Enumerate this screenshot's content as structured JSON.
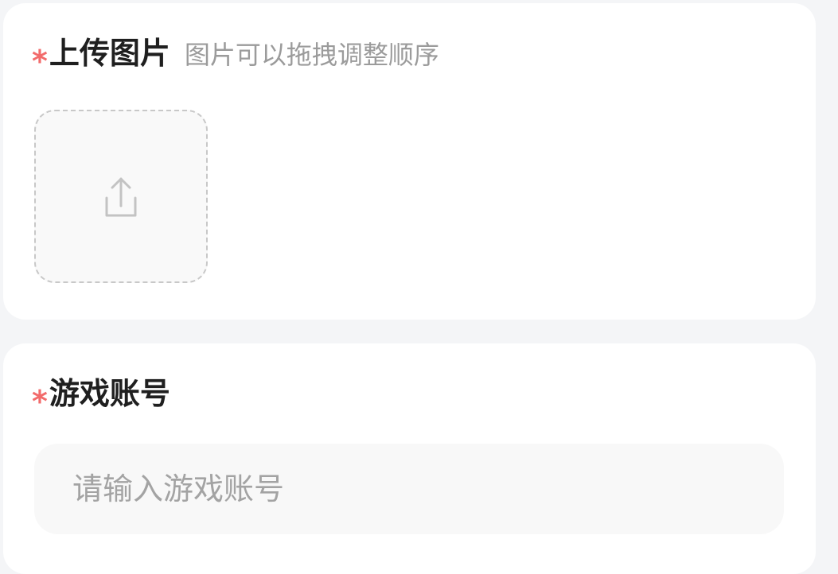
{
  "upload_section": {
    "required_mark": "*",
    "title": "上传图片",
    "hint": "图片可以拖拽调整顺序",
    "upload_icon": "upload-icon"
  },
  "account_section": {
    "required_mark": "*",
    "title": "游戏账号",
    "input": {
      "value": "",
      "placeholder": "请输入游戏账号"
    }
  },
  "colors": {
    "required_mark": "#f26b6b",
    "title": "#1f1f1f",
    "hint": "#9b9b9b",
    "placeholder": "#a3a3a3",
    "background": "#f4f5f7",
    "card": "#ffffff",
    "field_fill": "#f8f8f8"
  }
}
